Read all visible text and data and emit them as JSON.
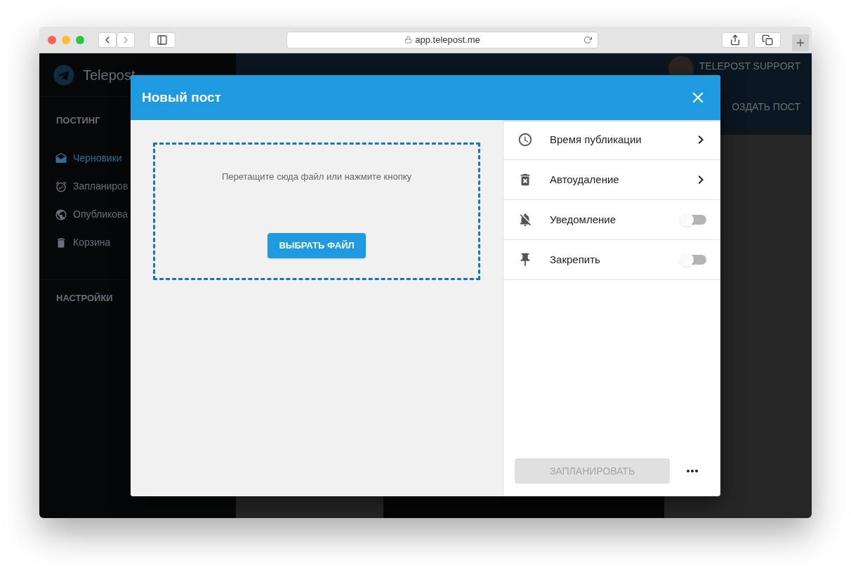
{
  "browser": {
    "url": "app.telepost.me"
  },
  "app": {
    "logo": "Telepost",
    "sections": [
      {
        "title": "ПОСТИНГ",
        "items": [
          {
            "label": "Черновики",
            "selected": true
          },
          {
            "label": "Запланиров",
            "selected": false
          },
          {
            "label": "Опубликова",
            "selected": false
          },
          {
            "label": "Корзина",
            "selected": false
          }
        ]
      },
      {
        "title": "НАСТРОЙКИ"
      }
    ],
    "user": "TELEPOST SUPPORT",
    "create_button": "ОЗДАТЬ ПОСТ"
  },
  "dialog": {
    "title": "Новый пост",
    "dropzone": {
      "hint": "Перетащите сюда файл или нажмите кнопку",
      "button": "ВЫБРАТЬ ФАЙЛ"
    },
    "settings": [
      {
        "kind": "nav",
        "label": "Время публикации"
      },
      {
        "kind": "nav",
        "label": "Автоудаление"
      },
      {
        "kind": "toggle",
        "label": "Уведомление",
        "on": false
      },
      {
        "kind": "toggle",
        "label": "Закрепить",
        "on": false
      }
    ],
    "schedule_button": {
      "label": "ЗАПЛАНИРОВАТЬ",
      "disabled": true
    }
  }
}
